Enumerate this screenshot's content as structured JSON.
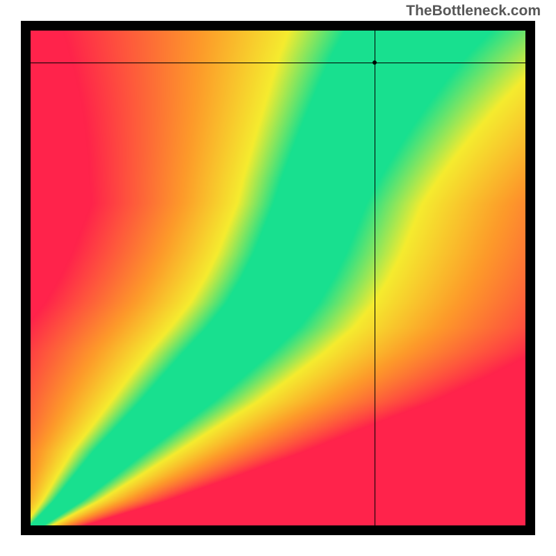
{
  "watermark": "TheBottleneck.com",
  "chart_data": {
    "type": "heatmap",
    "title": "",
    "xlabel": "",
    "ylabel": "",
    "xlim": [
      0,
      1
    ],
    "ylim": [
      0,
      1
    ],
    "crosshair": {
      "x": 0.695,
      "y": 0.935
    },
    "marker": {
      "x": 0.695,
      "y": 0.935
    },
    "ridge": {
      "description": "Green optimal band center and half-width as functions of y (0..1)",
      "samples": [
        {
          "y": 0.0,
          "center_x": 0.01,
          "half_width": 0.01
        },
        {
          "y": 0.05,
          "center_x": 0.07,
          "half_width": 0.02
        },
        {
          "y": 0.1,
          "center_x": 0.12,
          "half_width": 0.028
        },
        {
          "y": 0.15,
          "center_x": 0.17,
          "half_width": 0.035
        },
        {
          "y": 0.2,
          "center_x": 0.225,
          "half_width": 0.04
        },
        {
          "y": 0.25,
          "center_x": 0.28,
          "half_width": 0.045
        },
        {
          "y": 0.3,
          "center_x": 0.33,
          "half_width": 0.048
        },
        {
          "y": 0.35,
          "center_x": 0.38,
          "half_width": 0.05
        },
        {
          "y": 0.4,
          "center_x": 0.43,
          "half_width": 0.05
        },
        {
          "y": 0.45,
          "center_x": 0.47,
          "half_width": 0.048
        },
        {
          "y": 0.5,
          "center_x": 0.5,
          "half_width": 0.046
        },
        {
          "y": 0.55,
          "center_x": 0.525,
          "half_width": 0.044
        },
        {
          "y": 0.6,
          "center_x": 0.545,
          "half_width": 0.042
        },
        {
          "y": 0.65,
          "center_x": 0.565,
          "half_width": 0.04
        },
        {
          "y": 0.7,
          "center_x": 0.585,
          "half_width": 0.04
        },
        {
          "y": 0.75,
          "center_x": 0.608,
          "half_width": 0.04
        },
        {
          "y": 0.8,
          "center_x": 0.632,
          "half_width": 0.04
        },
        {
          "y": 0.85,
          "center_x": 0.658,
          "half_width": 0.04
        },
        {
          "y": 0.9,
          "center_x": 0.685,
          "half_width": 0.04
        },
        {
          "y": 0.95,
          "center_x": 0.715,
          "half_width": 0.04
        },
        {
          "y": 1.0,
          "center_x": 0.75,
          "half_width": 0.04
        }
      ]
    },
    "falloff": {
      "right_scale_min": 0.22,
      "right_scale_max": 0.6,
      "left_scale": 0.18,
      "comment": "Color transitions green->yellow->orange->red based on |x-center|/half_width; asymmetric scaling"
    },
    "palette": {
      "green": "#18e08f",
      "yellow": "#f5ec2f",
      "orange": "#fd9c2a",
      "red": "#ff234b"
    }
  }
}
